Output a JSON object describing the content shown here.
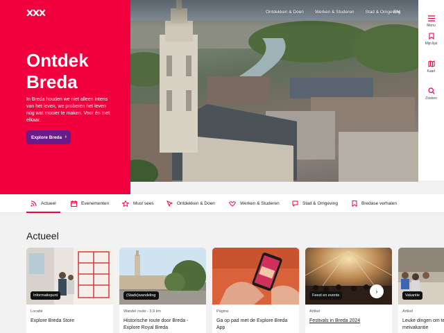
{
  "colors": {
    "brand_red": "#f0003c",
    "button_purple": "#6a1b8a",
    "text_dark": "#1a1a1a"
  },
  "header": {
    "logo_icon": "xxx-logo-icon",
    "nav": [
      "Ontdekken & Doen",
      "Werken & Studeren",
      "Stad & Omgeving"
    ],
    "language": "EN"
  },
  "hero": {
    "title_line1": "Ontdek",
    "title_line2": "Breda",
    "text": "In Breda houden we niet alleen intens van het leven, we proberen het leven nóg wat mooier te maken. Voor én met elkaar.",
    "button_label": "Explore Breda",
    "button_icon": "chevron-right-icon"
  },
  "rail": [
    {
      "label": "Menu",
      "icon": "menu-icon"
    },
    {
      "label": "Mijn lijst",
      "icon": "bookmark-icon"
    },
    {
      "label": "Kaart",
      "icon": "map-icon"
    },
    {
      "label": "Zoeken",
      "icon": "search-icon"
    }
  ],
  "tabs": [
    {
      "label": "Actueel",
      "icon": "rss-icon",
      "active": true
    },
    {
      "label": "Evenementen",
      "icon": "calendar-icon"
    },
    {
      "label": "Must sees",
      "icon": "star-icon"
    },
    {
      "label": "Ontdekken & Doen",
      "icon": "cursor-icon"
    },
    {
      "label": "Werken & Studeren",
      "icon": "shake-icon"
    },
    {
      "label": "Stad & Omgeving",
      "icon": "speech-icon"
    },
    {
      "label": "Bredase verhalen",
      "icon": "bookmark-icon"
    }
  ],
  "section": {
    "title": "Actueel",
    "cards": [
      {
        "badge": "Informatiepunt",
        "category": "Locatie",
        "title": "Explore Breda Store"
      },
      {
        "badge": "(Stads)wandeling",
        "category": "Wandel route - 3,9 km",
        "title": "Historische route door Breda - Explore Royal Breda"
      },
      {
        "badge": "",
        "category": "Pagina",
        "title": "Ga op pad met de Explore Breda App"
      },
      {
        "badge": "Feest en events",
        "category": "Artikel",
        "title": "Festivals in Breda 2024"
      },
      {
        "badge": "Vakantie",
        "category": "Artikel",
        "title": "Leuke dingen om te doen in de meivakantie"
      }
    ],
    "next_icon": "chevron-right-icon"
  }
}
